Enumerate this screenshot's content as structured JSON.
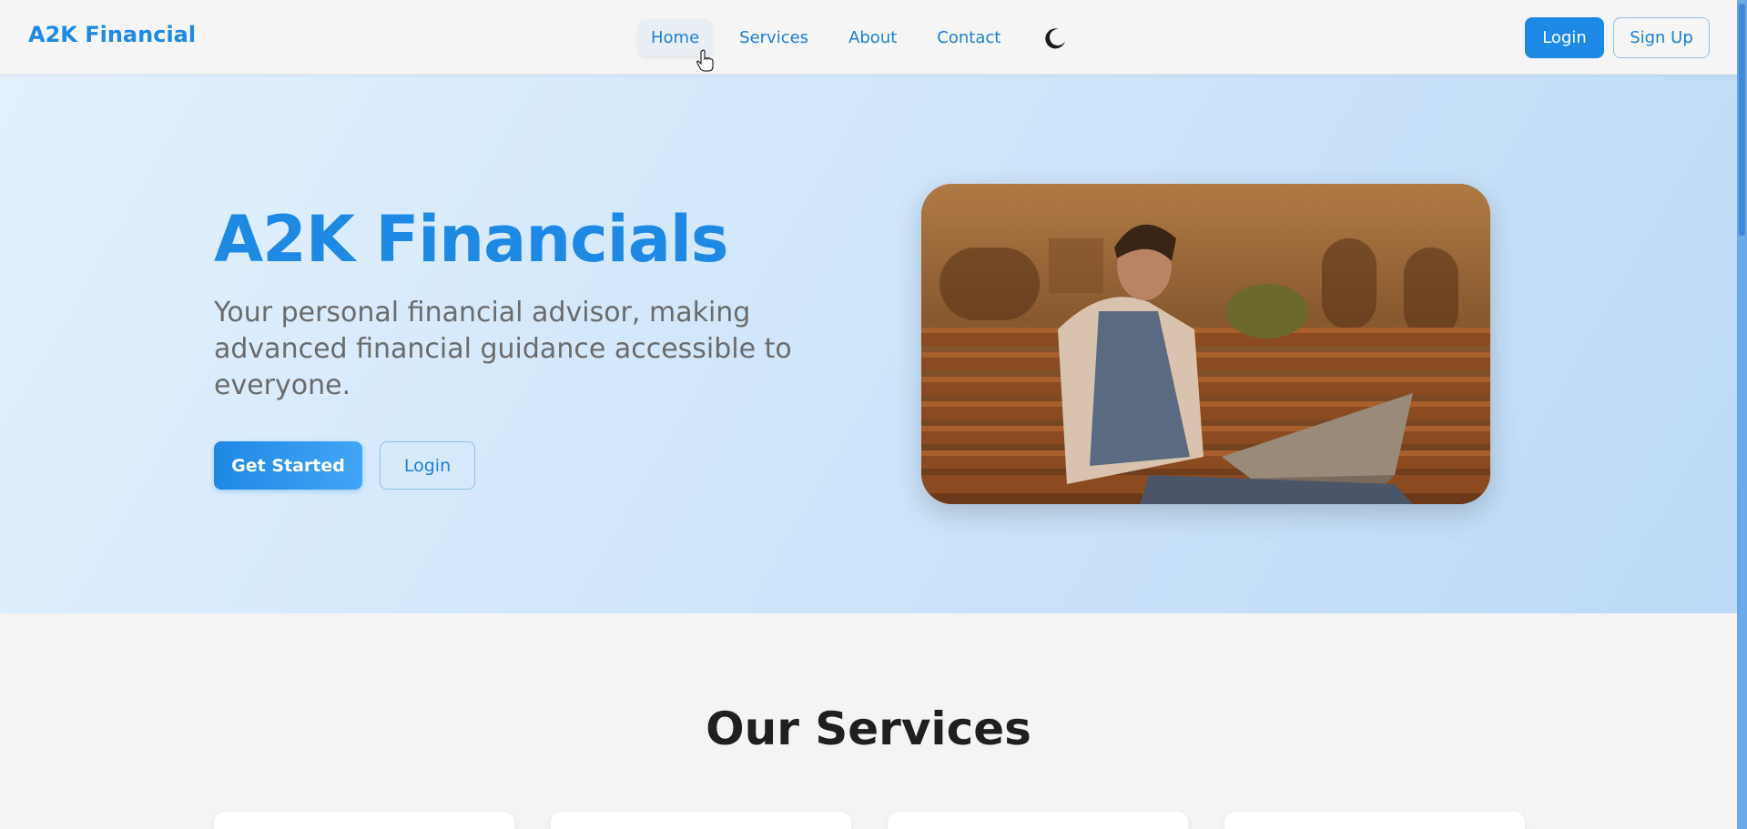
{
  "navbar": {
    "brand": "A2K Financial",
    "links": [
      {
        "label": "Home",
        "active": true
      },
      {
        "label": "Services",
        "active": false
      },
      {
        "label": "About",
        "active": false
      },
      {
        "label": "Contact",
        "active": false
      }
    ],
    "theme_toggle_icon": "moon-icon",
    "login_label": "Login",
    "signup_label": "Sign Up"
  },
  "hero": {
    "title": "A2K Financials",
    "subtitle": "Your personal financial advisor, making advanced financial guidance accessible to everyone.",
    "primary_button": "Get Started",
    "secondary_button": "Login"
  },
  "services": {
    "title": "Our Services"
  },
  "colors": {
    "accent": "#1e88e5",
    "hero_bg": "#cfe5fa",
    "page_bg": "#f4f4f4"
  }
}
